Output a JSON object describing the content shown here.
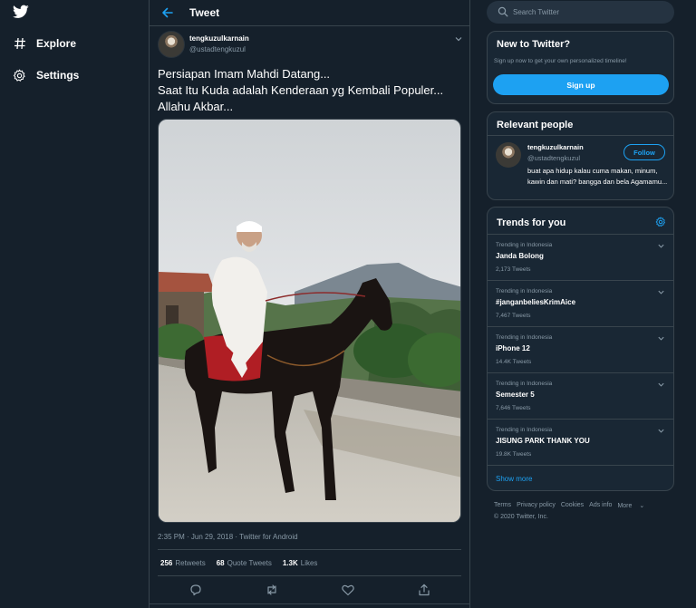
{
  "nav": {
    "explore_label": "Explore",
    "settings_label": "Settings"
  },
  "header": {
    "title": "Tweet"
  },
  "tweet": {
    "author_name": "tengkuzulkarnain",
    "author_handle": "@ustadtengkuzul",
    "text": "Persiapan Imam Mahdi Datang...\nSaat Itu Kuda adalah Kenderaan yg Kembali Populer...\nAllahu Akbar...",
    "meta": "2:35 PM · Jun 29, 2018 · Twitter for Android",
    "retweets_count": "256",
    "retweets_label": "Retweets",
    "quotes_count": "68",
    "quotes_label": "Quote Tweets",
    "likes_count": "1.3K",
    "likes_label": "Likes"
  },
  "search": {
    "placeholder": "Search Twitter"
  },
  "new_to_twitter": {
    "title": "New to Twitter?",
    "subtitle": "Sign up now to get your own personalized timeline!",
    "signup_label": "Sign up"
  },
  "relevant": {
    "title": "Relevant people",
    "name": "tengkuzulkarnain",
    "handle": "@ustadtengkuzul",
    "follow_label": "Follow",
    "bio": "buat apa hidup kalau cuma makan, minum, kawin dan mati? bangga dan bela Agamamu..."
  },
  "trends": {
    "title": "Trends for you",
    "items": [
      {
        "context": "Trending in Indonesia",
        "name": "Janda Bolong",
        "count": "2,173 Tweets"
      },
      {
        "context": "Trending in Indonesia",
        "name": "#janganbeliesKrimAice",
        "count": "7,467 Tweets"
      },
      {
        "context": "Trending in Indonesia",
        "name": "iPhone 12",
        "count": "14.4K Tweets"
      },
      {
        "context": "Trending in Indonesia",
        "name": "Semester 5",
        "count": "7,646 Tweets"
      },
      {
        "context": "Trending in Indonesia",
        "name": "JISUNG PARK THANK YOU",
        "count": "19.8K Tweets"
      }
    ],
    "show_more_label": "Show more"
  },
  "footer": {
    "links": [
      "Terms",
      "Privacy policy",
      "Cookies",
      "Ads info",
      "More"
    ],
    "copyright": "© 2020 Twitter, Inc."
  },
  "colors": {
    "background": "#15202b",
    "card": "#192734",
    "border": "#38444d",
    "accent": "#1da1f2",
    "muted": "#8899a6"
  }
}
